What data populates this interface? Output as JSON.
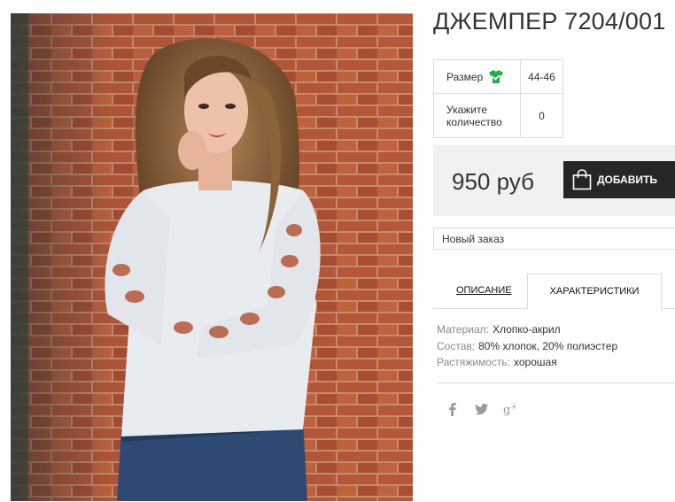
{
  "product": {
    "title": "ДЖЕМПЕР 7204/001",
    "photo_alt": "Model wearing white sweater with cutout sleeves"
  },
  "options": {
    "size_label": "Размер",
    "size_value": "44-46",
    "size_icon": "tshirt-icon",
    "qty_label_line1": "Укажите",
    "qty_label_line2": "количество",
    "qty_value": "0"
  },
  "purchase": {
    "price": "950 руб",
    "add_button_label": "ДОБАВИТЬ",
    "add_button_icon": "shopping-bag-icon"
  },
  "order": {
    "selected": "Новый заказ"
  },
  "tabs": [
    {
      "label": "ОПИСАНИЕ",
      "active": false
    },
    {
      "label": "ХАРАКТЕРИСТИКИ",
      "active": true
    }
  ],
  "specs": [
    {
      "key": "Материал:",
      "value": "Хлопко-акрил"
    },
    {
      "key": "Состав:",
      "value": "80% хлопок, 20% полиэстер"
    },
    {
      "key": "Растяжимость:",
      "value": "хорошая"
    }
  ],
  "social": [
    "facebook-icon",
    "twitter-icon",
    "google-plus-icon"
  ],
  "colors": {
    "accent_green": "#22b04c",
    "button_dark": "#262626",
    "price_bg": "#f1f1f1",
    "border": "#dcdcdc"
  }
}
